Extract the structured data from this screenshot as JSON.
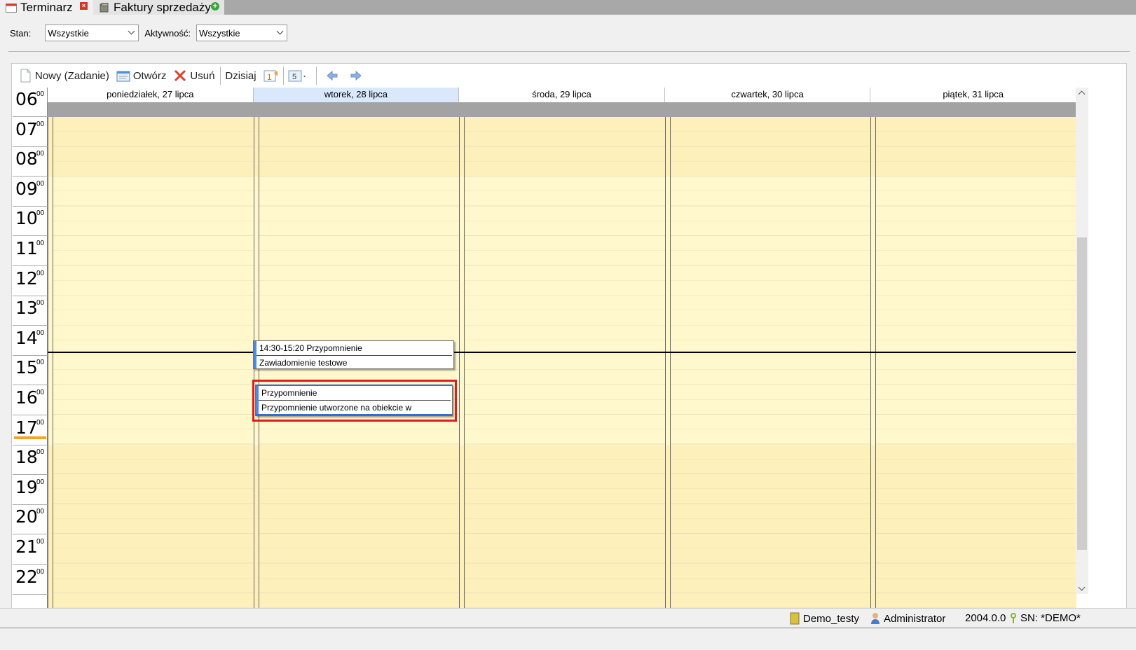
{
  "tabs": [
    {
      "label": "Terminarz",
      "icon": "calendar-icon",
      "active": true
    },
    {
      "label": "Faktury sprzedaży",
      "icon": "invoice-icon",
      "active": false
    }
  ],
  "filters": {
    "stan_label": "Stan:",
    "stan_value": "Wszystkie",
    "aktywnosc_label": "Aktywność:",
    "aktywnosc_value": "Wszystkie"
  },
  "toolbar": {
    "new_label": "Nowy (Zadanie)",
    "open_label": "Otwórz",
    "delete_label": "Usuń",
    "today_label": "Dzisiaj",
    "day_view_number": "1",
    "week_view_number": "5"
  },
  "calendar": {
    "hours": [
      "06",
      "07",
      "08",
      "09",
      "10",
      "11",
      "12",
      "13",
      "14",
      "15",
      "16",
      "17",
      "18",
      "19",
      "20",
      "21",
      "22"
    ],
    "minutes": "00",
    "days": [
      {
        "label": "poniedziałek, 27 lipca",
        "today": false
      },
      {
        "label": "wtorek, 28 lipca",
        "today": true
      },
      {
        "label": "środa, 29 lipca",
        "today": false
      },
      {
        "label": "czwartek, 30 lipca",
        "today": false
      },
      {
        "label": "piątek, 31 lipca",
        "today": false
      }
    ],
    "appointments": [
      {
        "line1": "14:30-15:20 Przypomnienie",
        "line2": "Zawiadomienie testowe"
      },
      {
        "line1": "Przypomnienie",
        "line2": "Przypomnienie utworzone na obiekcie w"
      }
    ]
  },
  "status": {
    "database": "Demo_testy",
    "user": "Administrator",
    "version": "2004.0.0",
    "serial": "SN: *DEMO*"
  },
  "colors": {
    "accent_today": "#d9e9fb",
    "highlight": "#e01a22",
    "appointment_bar": "#4a8ae8",
    "workhours": "#fff8cc",
    "offhours": "#fef0bb"
  }
}
